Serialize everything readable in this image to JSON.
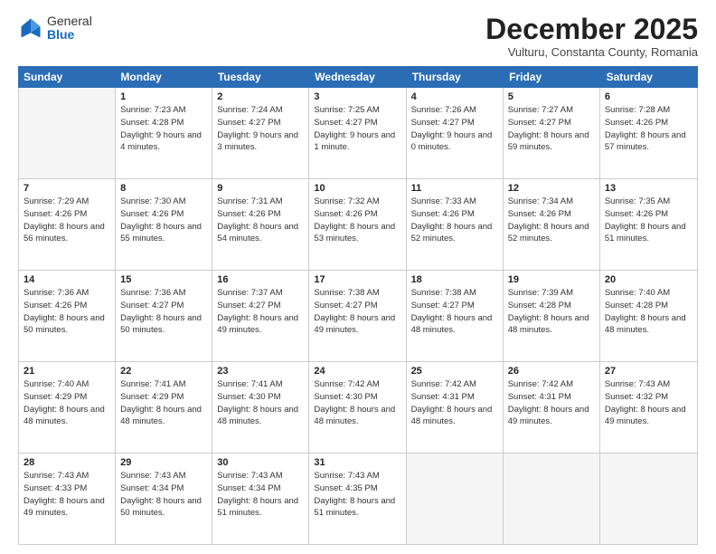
{
  "logo": {
    "general": "General",
    "blue": "Blue"
  },
  "header": {
    "month": "December 2025",
    "location": "Vulturu, Constanta County, Romania"
  },
  "days_of_week": [
    "Sunday",
    "Monday",
    "Tuesday",
    "Wednesday",
    "Thursday",
    "Friday",
    "Saturday"
  ],
  "weeks": [
    [
      {
        "day": "",
        "empty": true
      },
      {
        "day": "1",
        "rise": "7:23 AM",
        "set": "4:28 PM",
        "daylight": "9 hours and 4 minutes."
      },
      {
        "day": "2",
        "rise": "7:24 AM",
        "set": "4:27 PM",
        "daylight": "9 hours and 3 minutes."
      },
      {
        "day": "3",
        "rise": "7:25 AM",
        "set": "4:27 PM",
        "daylight": "9 hours and 1 minute."
      },
      {
        "day": "4",
        "rise": "7:26 AM",
        "set": "4:27 PM",
        "daylight": "9 hours and 0 minutes."
      },
      {
        "day": "5",
        "rise": "7:27 AM",
        "set": "4:27 PM",
        "daylight": "8 hours and 59 minutes."
      },
      {
        "day": "6",
        "rise": "7:28 AM",
        "set": "4:26 PM",
        "daylight": "8 hours and 57 minutes."
      }
    ],
    [
      {
        "day": "7",
        "rise": "7:29 AM",
        "set": "4:26 PM",
        "daylight": "8 hours and 56 minutes."
      },
      {
        "day": "8",
        "rise": "7:30 AM",
        "set": "4:26 PM",
        "daylight": "8 hours and 55 minutes."
      },
      {
        "day": "9",
        "rise": "7:31 AM",
        "set": "4:26 PM",
        "daylight": "8 hours and 54 minutes."
      },
      {
        "day": "10",
        "rise": "7:32 AM",
        "set": "4:26 PM",
        "daylight": "8 hours and 53 minutes."
      },
      {
        "day": "11",
        "rise": "7:33 AM",
        "set": "4:26 PM",
        "daylight": "8 hours and 52 minutes."
      },
      {
        "day": "12",
        "rise": "7:34 AM",
        "set": "4:26 PM",
        "daylight": "8 hours and 52 minutes."
      },
      {
        "day": "13",
        "rise": "7:35 AM",
        "set": "4:26 PM",
        "daylight": "8 hours and 51 minutes."
      }
    ],
    [
      {
        "day": "14",
        "rise": "7:36 AM",
        "set": "4:26 PM",
        "daylight": "8 hours and 50 minutes."
      },
      {
        "day": "15",
        "rise": "7:36 AM",
        "set": "4:27 PM",
        "daylight": "8 hours and 50 minutes."
      },
      {
        "day": "16",
        "rise": "7:37 AM",
        "set": "4:27 PM",
        "daylight": "8 hours and 49 minutes."
      },
      {
        "day": "17",
        "rise": "7:38 AM",
        "set": "4:27 PM",
        "daylight": "8 hours and 49 minutes."
      },
      {
        "day": "18",
        "rise": "7:38 AM",
        "set": "4:27 PM",
        "daylight": "8 hours and 48 minutes."
      },
      {
        "day": "19",
        "rise": "7:39 AM",
        "set": "4:28 PM",
        "daylight": "8 hours and 48 minutes."
      },
      {
        "day": "20",
        "rise": "7:40 AM",
        "set": "4:28 PM",
        "daylight": "8 hours and 48 minutes."
      }
    ],
    [
      {
        "day": "21",
        "rise": "7:40 AM",
        "set": "4:29 PM",
        "daylight": "8 hours and 48 minutes."
      },
      {
        "day": "22",
        "rise": "7:41 AM",
        "set": "4:29 PM",
        "daylight": "8 hours and 48 minutes."
      },
      {
        "day": "23",
        "rise": "7:41 AM",
        "set": "4:30 PM",
        "daylight": "8 hours and 48 minutes."
      },
      {
        "day": "24",
        "rise": "7:42 AM",
        "set": "4:30 PM",
        "daylight": "8 hours and 48 minutes."
      },
      {
        "day": "25",
        "rise": "7:42 AM",
        "set": "4:31 PM",
        "daylight": "8 hours and 48 minutes."
      },
      {
        "day": "26",
        "rise": "7:42 AM",
        "set": "4:31 PM",
        "daylight": "8 hours and 49 minutes."
      },
      {
        "day": "27",
        "rise": "7:43 AM",
        "set": "4:32 PM",
        "daylight": "8 hours and 49 minutes."
      }
    ],
    [
      {
        "day": "28",
        "rise": "7:43 AM",
        "set": "4:33 PM",
        "daylight": "8 hours and 49 minutes."
      },
      {
        "day": "29",
        "rise": "7:43 AM",
        "set": "4:34 PM",
        "daylight": "8 hours and 50 minutes."
      },
      {
        "day": "30",
        "rise": "7:43 AM",
        "set": "4:34 PM",
        "daylight": "8 hours and 51 minutes."
      },
      {
        "day": "31",
        "rise": "7:43 AM",
        "set": "4:35 PM",
        "daylight": "8 hours and 51 minutes."
      },
      {
        "day": "",
        "empty": true
      },
      {
        "day": "",
        "empty": true
      },
      {
        "day": "",
        "empty": true
      }
    ]
  ]
}
